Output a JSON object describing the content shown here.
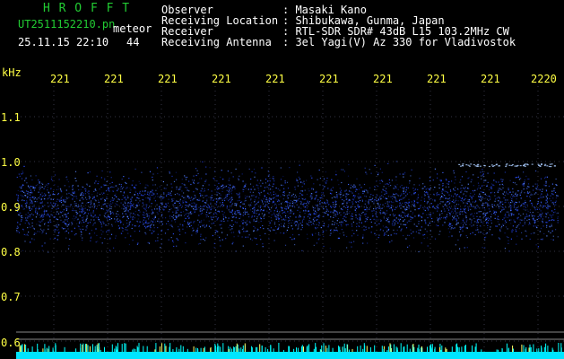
{
  "header": {
    "brand": "H R O F F T",
    "filename": "UT2511152210.pn",
    "mode": "meteor",
    "datetime": "25.11.15 22:10",
    "count": "44"
  },
  "station": {
    "rows": [
      {
        "label": "Observer",
        "value": ": Masaki Kano"
      },
      {
        "label": "Receiving Location",
        "value": ": Shibukawa, Gunma, Japan"
      },
      {
        "label": "Receiver",
        "value": ": RTL-SDR SDR# 43dB L15 103.2MHz CW"
      },
      {
        "label": "Receiving Antenna",
        "value": ": 3el Yagi(V) Az 330 for Vladivostok"
      }
    ]
  },
  "axis": {
    "unit": "kHz",
    "y_ticks": [
      "1.1",
      "1.0",
      "0.9",
      "0.8",
      "0.7",
      "0.6"
    ],
    "x_ticks": [
      "221",
      "221",
      "221",
      "221",
      "221",
      "221",
      "221",
      "221",
      "221",
      "2220"
    ]
  },
  "colors": {
    "background": "#000000",
    "signal": "#2a4dff",
    "noise_strip": "#00e5ff",
    "tick_text": "#ffff44",
    "label_text": "#ffffff",
    "brand": "#22cc33"
  }
}
